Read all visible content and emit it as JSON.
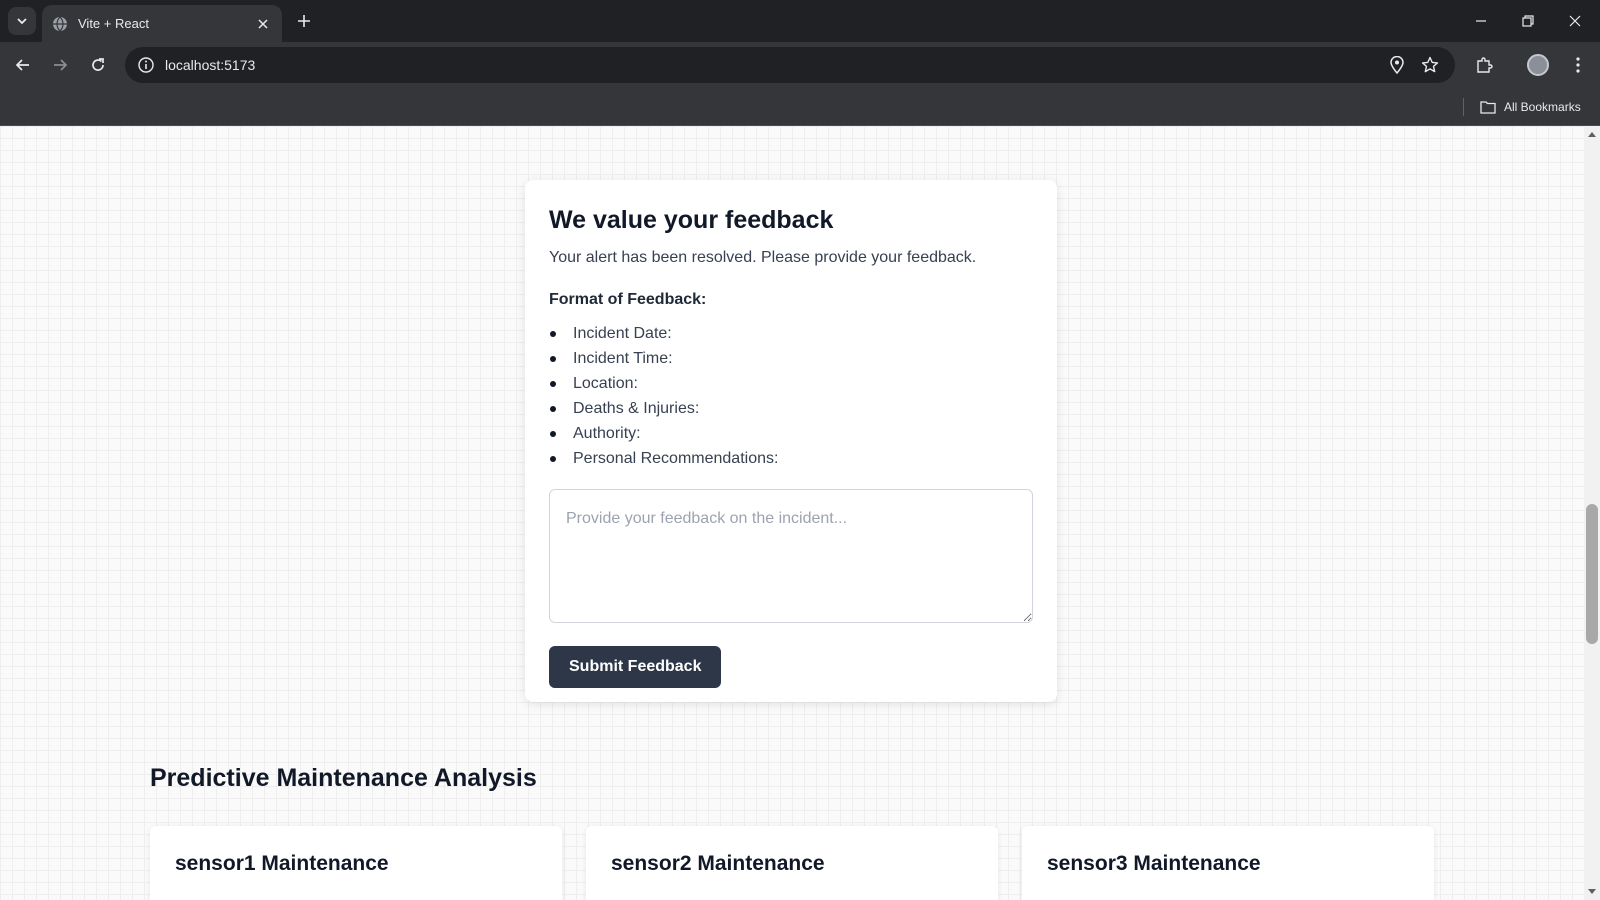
{
  "browser": {
    "tab_title": "Vite + React",
    "url": "localhost:5173",
    "bookmarks_label": "All Bookmarks"
  },
  "feedback": {
    "title": "We value your feedback",
    "subtitle": "Your alert has been resolved. Please provide your feedback.",
    "format_label": "Format of Feedback:",
    "items": [
      "Incident Date:",
      "Incident Time:",
      "Location:",
      "Deaths & Injuries:",
      "Authority:",
      "Personal Recommendations:"
    ],
    "textarea_placeholder": "Provide your feedback on the incident...",
    "submit_label": "Submit Feedback"
  },
  "maintenance": {
    "title": "Predictive Maintenance Analysis",
    "cards": [
      {
        "title": "sensor1 Maintenance"
      },
      {
        "title": "sensor2 Maintenance"
      },
      {
        "title": "sensor3 Maintenance"
      }
    ]
  },
  "colors": {
    "button_bg": "#2d3748",
    "chrome_dark": "#202124",
    "chrome_toolbar": "#35363a"
  }
}
